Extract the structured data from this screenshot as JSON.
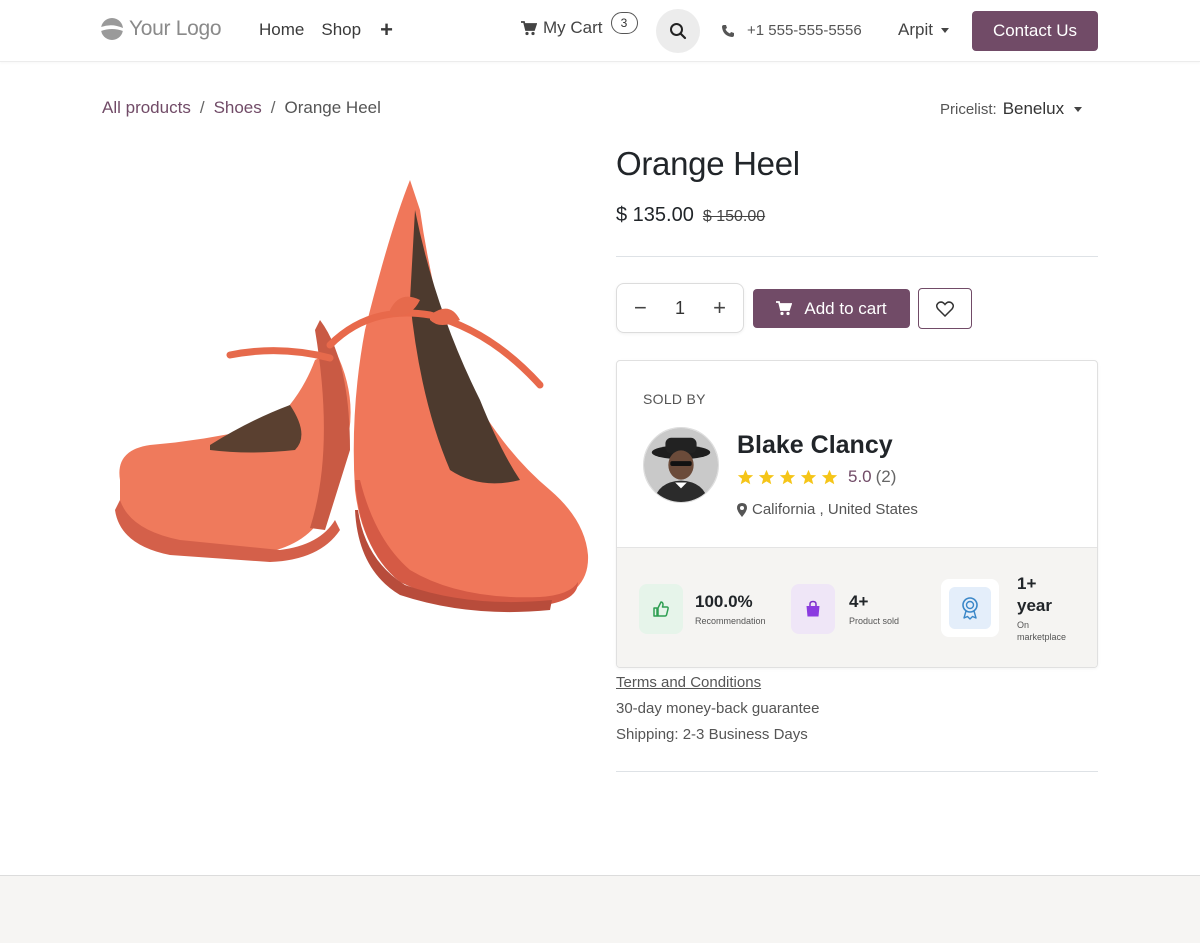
{
  "header": {
    "logo_text": "Your Logo",
    "nav": [
      "Home",
      "Shop"
    ],
    "nav_more": "+",
    "cart_label": "My Cart",
    "cart_count": "3",
    "phone": "+1 555-555-5556",
    "user": "Arpit",
    "contact_label": "Contact Us"
  },
  "breadcrumb": {
    "items": [
      "All products",
      "Shoes"
    ],
    "current": "Orange Heel",
    "separator": "/"
  },
  "pricelist": {
    "label": "Pricelist:",
    "value": "Benelux"
  },
  "product": {
    "name": "Orange Heel",
    "price": "$ 135.00",
    "old_price": "$ 150.00",
    "quantity": "1",
    "add_to_cart_label": "Add to cart",
    "image_icon": "orange-heel-shoes"
  },
  "seller": {
    "heading": "SOLD BY",
    "name": "Blake Clancy",
    "rating": "5.0",
    "rating_count": "(2)",
    "stars": 5,
    "location": "California , United States",
    "stats": [
      {
        "value": "100.0%",
        "label": "Recommendation",
        "icon": "thumbs-up-icon"
      },
      {
        "value": "4+",
        "label": "Product sold",
        "icon": "shopping-bag-icon"
      },
      {
        "value_line1": "1+",
        "value_line2": "year",
        "label_line1": "On",
        "label_line2": "marketplace",
        "icon": "award-icon"
      }
    ]
  },
  "info": {
    "terms": "Terms and Conditions",
    "guarantee": "30-day money-back guarantee",
    "shipping": "Shipping: 2-3 Business Days"
  },
  "colors": {
    "brand": "#714b67",
    "star": "#f5c518",
    "shoe": "#f0775a"
  }
}
